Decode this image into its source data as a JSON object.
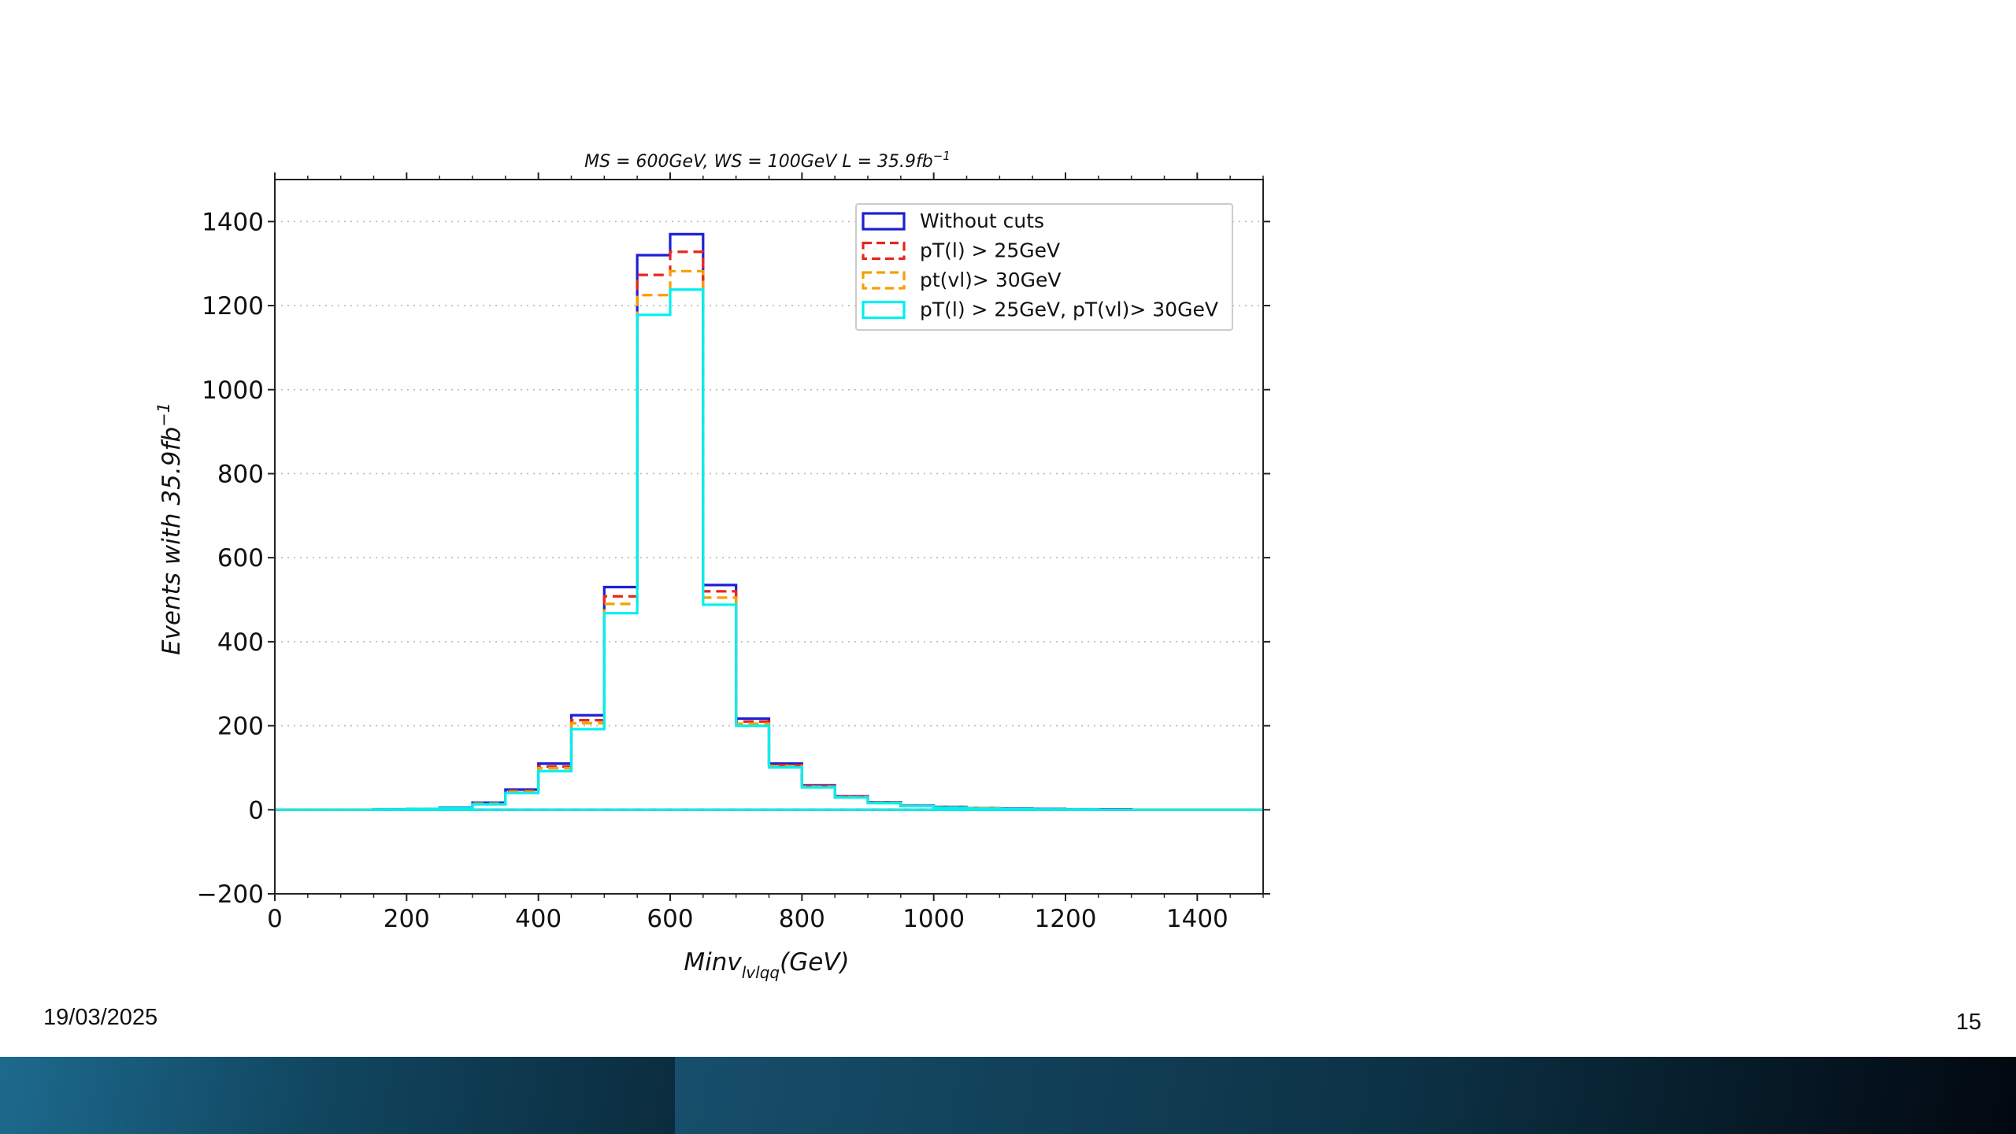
{
  "slide": {
    "date": "19/03/2025",
    "page_number": "15"
  },
  "chart_data": {
    "type": "step-histogram",
    "title_text": "MS = 600GeV, WS = 100GeV L = 35.9fb",
    "title_sup": "−1",
    "xlabel_main": "Minv",
    "xlabel_sub": "lvlqq",
    "xlabel_tail": "(GeV)",
    "ylabel_main": "Events with 35.9fb",
    "ylabel_sup": "−1",
    "xlim": [
      0,
      1500
    ],
    "ylim": [
      -200,
      1500
    ],
    "xticks": [
      0,
      200,
      400,
      600,
      800,
      1000,
      1200,
      1400
    ],
    "xtick_labels": [
      "0",
      "200",
      "400",
      "600",
      "800",
      "1000",
      "1200",
      "1400"
    ],
    "yticks": [
      -200,
      0,
      200,
      400,
      600,
      800,
      1000,
      1200,
      1400
    ],
    "ytick_labels": [
      "−200",
      "0",
      "200",
      "400",
      "600",
      "800",
      "1000",
      "1200",
      "1400"
    ],
    "grid": "y-dotted",
    "legend_position": "top-right",
    "bin_edges": [
      0,
      50,
      100,
      150,
      200,
      250,
      300,
      350,
      400,
      450,
      500,
      550,
      600,
      650,
      700,
      750,
      800,
      850,
      900,
      950,
      1000,
      1050,
      1100,
      1150,
      1200,
      1250,
      1300,
      1350,
      1400,
      1450,
      1500
    ],
    "series": [
      {
        "name": "Without cuts",
        "color": "#1f1fd6",
        "style": "solid",
        "values": [
          0,
          0,
          0,
          1,
          2,
          5,
          17,
          48,
          110,
          225,
          530,
          1320,
          1370,
          535,
          217,
          110,
          58,
          32,
          18,
          10,
          7,
          4,
          3,
          2,
          1,
          1,
          0,
          0,
          0,
          0
        ]
      },
      {
        "name": "pT(l) > 25GeV",
        "color": "#e8261c",
        "style": "dashed",
        "values": [
          0,
          0,
          0,
          1,
          2,
          4,
          15,
          45,
          103,
          213,
          508,
          1273,
          1328,
          520,
          210,
          106,
          56,
          31,
          17,
          9,
          6,
          4,
          2,
          1,
          1,
          0,
          0,
          0,
          0,
          0
        ]
      },
      {
        "name": "pt(vl)> 30GeV",
        "color": "#f5a000",
        "style": "dashed",
        "values": [
          0,
          0,
          0,
          1,
          2,
          4,
          15,
          43,
          99,
          206,
          490,
          1225,
          1282,
          505,
          205,
          104,
          55,
          30,
          17,
          9,
          6,
          4,
          2,
          1,
          1,
          0,
          0,
          0,
          0,
          0
        ]
      },
      {
        "name": "pT(l) > 25GeV, pT(vl)> 30GeV",
        "color": "#00f0f0",
        "style": "solid",
        "values": [
          0,
          0,
          0,
          1,
          2,
          4,
          13,
          40,
          92,
          192,
          468,
          1178,
          1238,
          488,
          200,
          101,
          53,
          29,
          16,
          9,
          5,
          3,
          2,
          1,
          1,
          0,
          0,
          0,
          0,
          0
        ]
      }
    ]
  }
}
